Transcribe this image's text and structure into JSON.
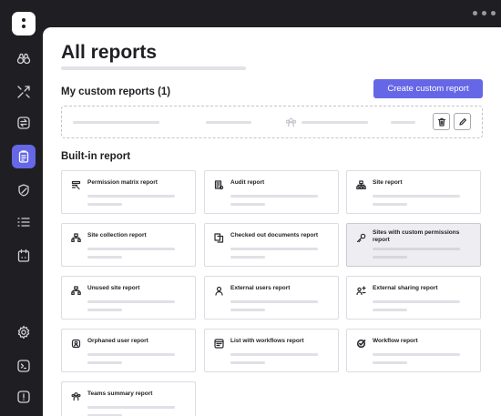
{
  "sidebar": {
    "items": [
      {
        "icon": "binoculars-icon"
      },
      {
        "icon": "arrows-cross-icon"
      },
      {
        "icon": "transfer-icon"
      },
      {
        "icon": "clipboard-icon",
        "active": true
      },
      {
        "icon": "shield-icon"
      },
      {
        "icon": "list-icon"
      },
      {
        "icon": "calendar-icon"
      },
      {
        "icon": "settings-icon"
      },
      {
        "icon": "terminal-icon"
      },
      {
        "icon": "feedback-icon"
      }
    ]
  },
  "page": {
    "title": "All reports"
  },
  "custom_reports": {
    "heading": "My custom reports (1)",
    "create_label": "Create custom report"
  },
  "built_in": {
    "heading": "Built-in report",
    "cards": [
      {
        "label": "Permission matrix report",
        "icon": "matrix-icon"
      },
      {
        "label": "Audit report",
        "icon": "audit-icon"
      },
      {
        "label": "Site report",
        "icon": "sitemap-icon"
      },
      {
        "label": "Site collection report",
        "icon": "sitemap-icon"
      },
      {
        "label": "Checked out documents report",
        "icon": "documents-icon"
      },
      {
        "label": "Sites with custom permissions report",
        "icon": "key-icon",
        "selected": true
      },
      {
        "label": "Unused site report",
        "icon": "sitemap-icon"
      },
      {
        "label": "External users report",
        "icon": "user-icon"
      },
      {
        "label": "External sharing report",
        "icon": "share-users-icon"
      },
      {
        "label": "Orphaned user report",
        "icon": "orphan-user-icon"
      },
      {
        "label": "List with workflows report",
        "icon": "list-workflow-icon"
      },
      {
        "label": "Workflow  report",
        "icon": "workflow-icon"
      },
      {
        "label": "Teams summary report",
        "icon": "teams-icon"
      }
    ]
  },
  "colors": {
    "accent": "#6567e6",
    "sidebar_bg": "#1f1f23"
  }
}
